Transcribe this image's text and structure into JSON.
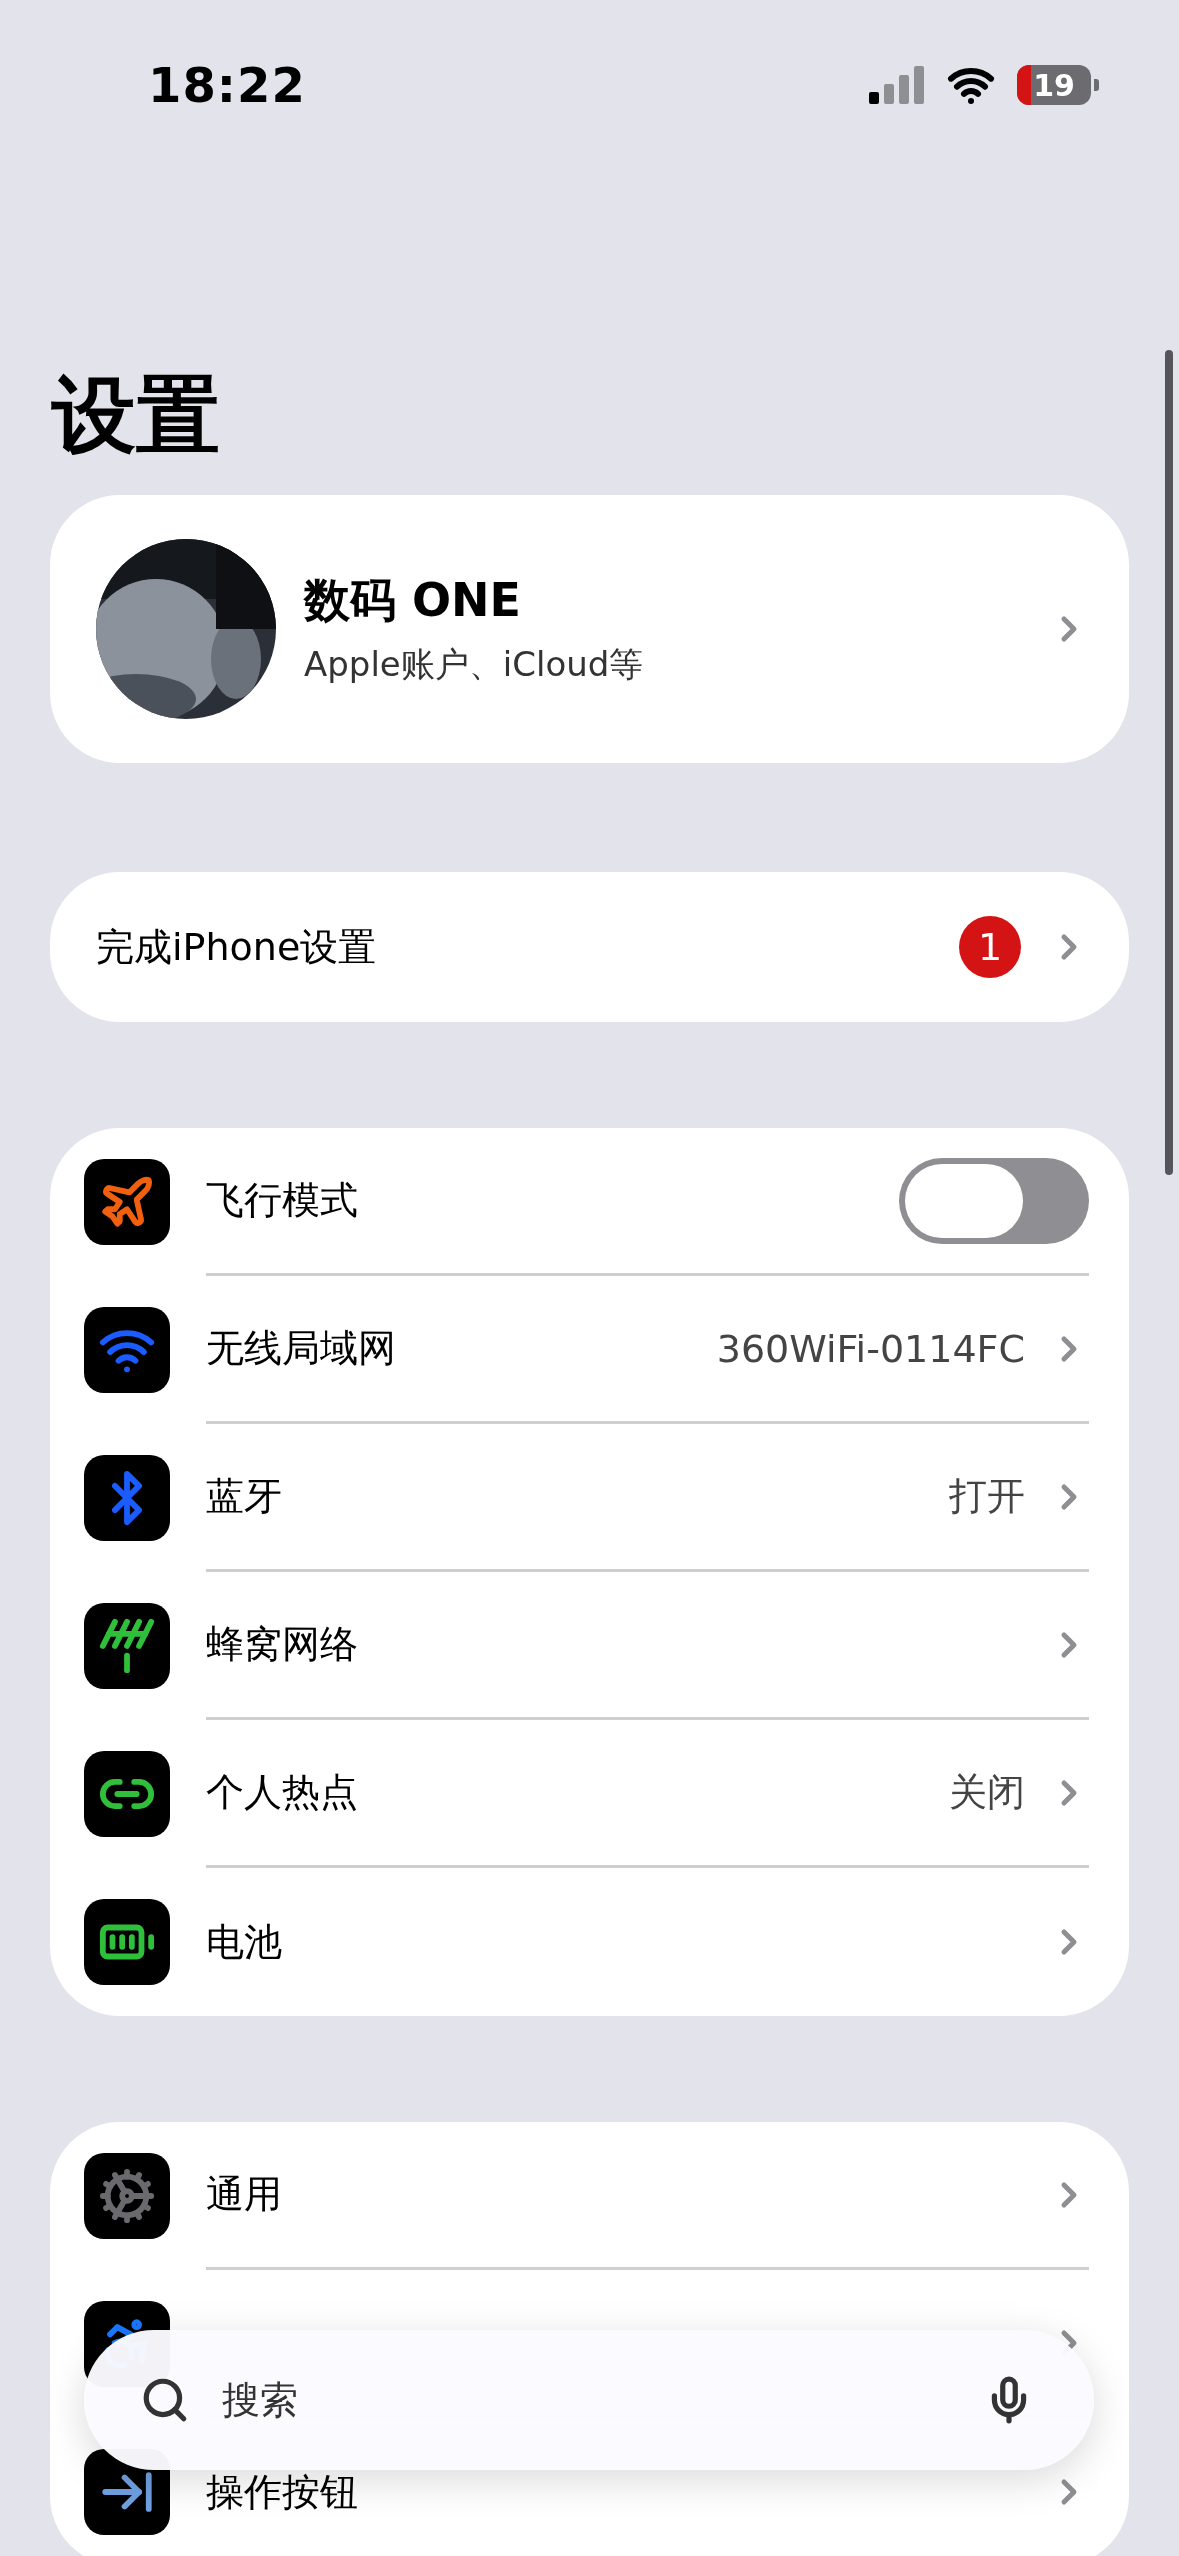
{
  "status_bar": {
    "time": "18:22",
    "battery": "19"
  },
  "title": "设置",
  "profile": {
    "name": "数码 ONE",
    "subtitle": "Apple账户、iCloud等"
  },
  "setup": {
    "label": "完成iPhone设置",
    "badge": "1"
  },
  "groups": [
    {
      "rows": [
        {
          "kind": "toggle",
          "label": "飞行模式",
          "on": false
        },
        {
          "kind": "link",
          "label": "无线局域网",
          "value": "360WiFi-0114FC"
        },
        {
          "kind": "link",
          "label": "蓝牙",
          "value": "打开"
        },
        {
          "kind": "link",
          "label": "蜂窝网络"
        },
        {
          "kind": "link",
          "label": "个人热点",
          "value": "关闭"
        },
        {
          "kind": "link",
          "label": "电池"
        }
      ]
    },
    {
      "rows": [
        {
          "kind": "link",
          "label": "通用"
        },
        {
          "kind": "link"
        },
        {
          "kind": "link",
          "label": "操作按钮"
        }
      ]
    }
  ],
  "search": {
    "placeholder": "搜索"
  }
}
